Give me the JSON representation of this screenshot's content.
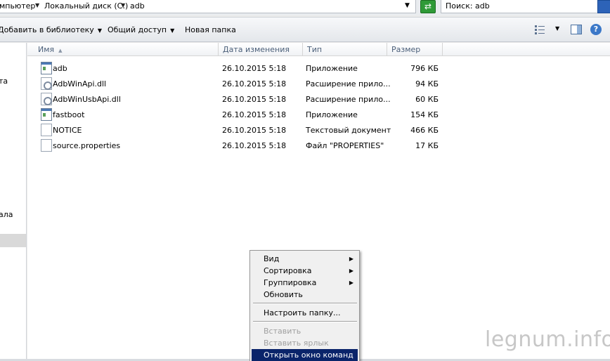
{
  "address": {
    "crumbs": [
      "мпьютер",
      "Локальный диск (C:)",
      "adb"
    ],
    "search_text": "Поиск: adb"
  },
  "toolbar": {
    "add_library": "Добавить в библиотеку",
    "share": "Общий доступ",
    "new_folder": "Новая папка"
  },
  "nav": {
    "fragments": [
      "та",
      "ала"
    ]
  },
  "columns": {
    "name": "Имя",
    "date": "Дата изменения",
    "type": "Тип",
    "size": "Размер"
  },
  "files": [
    {
      "name": "adb",
      "date": "26.10.2015 5:18",
      "type": "Приложение",
      "size": "796 КБ",
      "icon": "application-icon"
    },
    {
      "name": "AdbWinApi.dll",
      "date": "26.10.2015 5:18",
      "type": "Расширение прило...",
      "size": "94 КБ",
      "icon": "dll-icon"
    },
    {
      "name": "AdbWinUsbApi.dll",
      "date": "26.10.2015 5:18",
      "type": "Расширение прило...",
      "size": "60 КБ",
      "icon": "dll-icon"
    },
    {
      "name": "fastboot",
      "date": "26.10.2015 5:18",
      "type": "Приложение",
      "size": "154 КБ",
      "icon": "application-icon"
    },
    {
      "name": "NOTICE",
      "date": "26.10.2015 5:18",
      "type": "Текстовый документ",
      "size": "466 КБ",
      "icon": "document-icon"
    },
    {
      "name": "source.properties",
      "date": "26.10.2015 5:18",
      "type": "Файл \"PROPERTIES\"",
      "size": "17 КБ",
      "icon": "document-icon"
    }
  ],
  "context_menu": {
    "view": "Вид",
    "sort": "Сортировка",
    "group": "Группировка",
    "refresh": "Обновить",
    "customize": "Настроить папку...",
    "paste": "Вставить",
    "paste_shortcut": "Вставить ярлык",
    "open_cmd": "Открыть окно команд"
  },
  "watermark": "legnum.info",
  "colors": {
    "menu_highlight": "#0a246a",
    "refresh_green": "#2f9a37"
  }
}
